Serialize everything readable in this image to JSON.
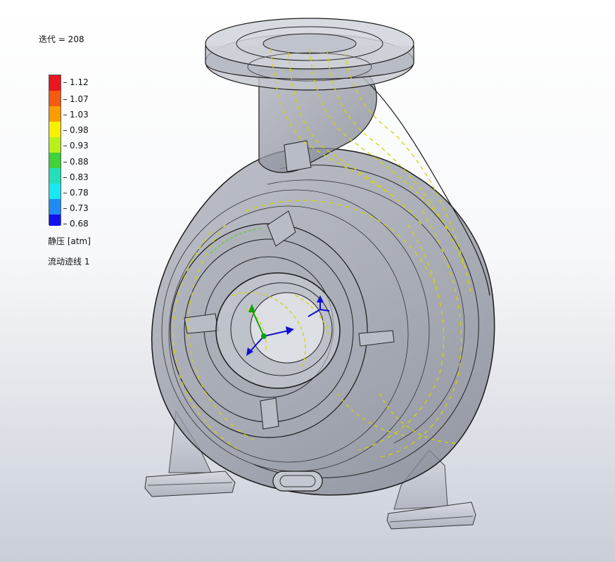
{
  "header": {
    "iteration": "迭代 = 208"
  },
  "legend": {
    "ticks": [
      "1.12",
      "1.07",
      "1.03",
      "0.98",
      "0.93",
      "0.88",
      "0.83",
      "0.78",
      "0.73",
      "0.68"
    ],
    "colors": [
      "#e8161e",
      "#f45a10",
      "#fc9c00",
      "#f7f000",
      "#b9f01c",
      "#3fd23a",
      "#22e0b8",
      "#18e8f4",
      "#1e8cf4",
      "#1212f0"
    ],
    "quantity": "静压 [atm]",
    "plot_name": "流动迹线 1"
  },
  "model": {
    "body_color": "#8f94a0",
    "edge_color": "#1a1a1a",
    "arrow_color": "#d4d400",
    "axis_colors": {
      "x": "#1010d0",
      "y": "#10a010",
      "z": "#1010d0"
    }
  }
}
